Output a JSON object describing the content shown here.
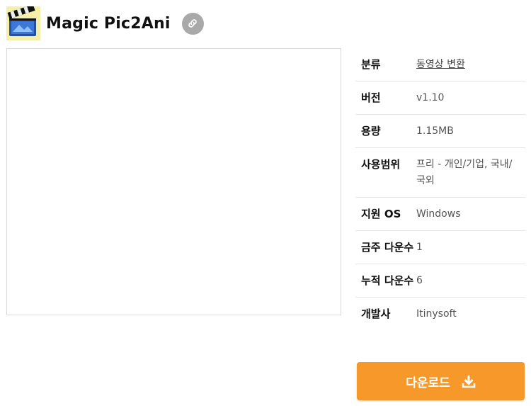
{
  "app": {
    "title": "Magic Pic2Ani",
    "icon": "clapperboard-icon",
    "link_icon": "link-icon"
  },
  "info": {
    "rows": [
      {
        "label": "분류",
        "value": "동영상 변환"
      },
      {
        "label": "버전",
        "value": "v1.10"
      },
      {
        "label": "용량",
        "value": "1.15MB"
      },
      {
        "label": "사용범위",
        "value": "프리 - 개인/기업, 국내/국외"
      },
      {
        "label": "지원 OS",
        "value": "Windows"
      },
      {
        "label": "금주 다운수",
        "value": "1"
      },
      {
        "label": "누적 다운수",
        "value": "6"
      },
      {
        "label": "개발사",
        "value": "Itinysoft"
      }
    ]
  },
  "download": {
    "label": "다운로드",
    "icon": "download-icon"
  },
  "colors": {
    "accent": "#f7992a",
    "link_button": "#a9a9a9"
  }
}
